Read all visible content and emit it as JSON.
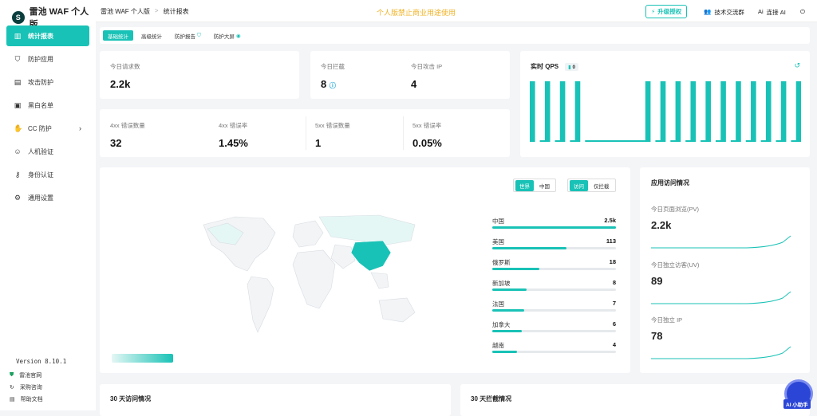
{
  "app": {
    "name": "雷池 WAF 个人版"
  },
  "nav": [
    {
      "label": "统计报表",
      "icon": "chart-bar-icon",
      "active": true
    },
    {
      "label": "防护应用",
      "icon": "shield-icon"
    },
    {
      "label": "攻击防护",
      "icon": "document-icon"
    },
    {
      "label": "黑白名单",
      "icon": "list-icon"
    },
    {
      "label": "CC 防护",
      "icon": "hand-icon",
      "arrow": "›"
    },
    {
      "label": "人机验证",
      "icon": "robot-icon"
    },
    {
      "label": "身份认证",
      "icon": "key-icon"
    },
    {
      "label": "通用设置",
      "icon": "gear-icon"
    }
  ],
  "version": "Version 8.10.1",
  "footer_links": [
    {
      "label": "雷池官网",
      "icon": "shield-check-icon"
    },
    {
      "label": "采购咨询",
      "icon": "refresh-icon"
    },
    {
      "label": "帮助文档",
      "icon": "doc-icon"
    }
  ],
  "topbar": {
    "crumbs": [
      "雷池 WAF 个人版",
      "统计报表"
    ],
    "separator": ">",
    "notice": "个人版禁止商业用途使用",
    "upgrade_label": "升级授权",
    "community_label": "技术交流群",
    "ai_label": "连接 AI",
    "logout_icon": "power-icon"
  },
  "subtabs": [
    "基础统计",
    "高级统计",
    "防护报告",
    "防护大屏"
  ],
  "stats_top": [
    {
      "label": "今日请求数",
      "value": "2.2k"
    },
    {
      "label": "今日拦截",
      "value": "8"
    },
    {
      "label": "今日攻击 IP",
      "value": "4"
    }
  ],
  "stats_err": [
    {
      "label": "4xx 错误数量",
      "value": "32"
    },
    {
      "label": "4xx 错误率",
      "value": "1.45%"
    },
    {
      "label": "5xx 错误数量",
      "value": "1"
    },
    {
      "label": "5xx 错误率",
      "value": "0.05%"
    }
  ],
  "qps": {
    "title": "实时 QPS",
    "badge": "0",
    "bars": [
      1,
      0,
      0.02,
      1,
      0,
      0.02,
      1,
      0,
      0.02,
      1,
      0,
      0.02,
      0.02,
      0.02,
      0.02,
      0.02,
      0.02,
      0.02,
      0.02,
      0.02,
      0.02,
      0.02,
      0.02,
      1,
      0,
      0.02,
      1,
      0,
      0.02,
      1,
      0,
      0.02,
      1,
      0,
      0.02,
      1,
      0,
      0.02,
      1,
      0,
      0.02,
      1,
      0,
      0.02,
      1,
      0,
      0.02,
      1,
      0,
      0.02,
      1,
      0,
      0.02,
      1
    ],
    "color": "#19c2b6"
  },
  "map": {
    "toggle_region": [
      "世界",
      "中国"
    ],
    "toggle_metric": [
      "访问",
      "仅拦截"
    ],
    "countries": [
      {
        "name": "中国",
        "value": "2.5k",
        "fill": 1.0
      },
      {
        "name": "美国",
        "value": "113",
        "fill": 0.6
      },
      {
        "name": "俄罗斯",
        "value": "18",
        "fill": 0.38
      },
      {
        "name": "新加坡",
        "value": "8",
        "fill": 0.28
      },
      {
        "name": "法国",
        "value": "7",
        "fill": 0.26
      },
      {
        "name": "加拿大",
        "value": "6",
        "fill": 0.24
      },
      {
        "name": "越南",
        "value": "4",
        "fill": 0.2
      }
    ]
  },
  "app_visits": {
    "title": "应用访问情况",
    "items": [
      {
        "label": "今日页面浏览(PV)",
        "value": "2.2k"
      },
      {
        "label": "今日独立访客(UV)",
        "value": "89"
      },
      {
        "label": "今日独立 IP",
        "value": "78"
      }
    ]
  },
  "bottom": {
    "visits_title": "30 天访问情况",
    "blocks_title": "30 天拦截情况"
  },
  "assistant": {
    "label": "AI 小助手"
  },
  "accent": "#19c2b6",
  "notice_color": "#f0b429"
}
